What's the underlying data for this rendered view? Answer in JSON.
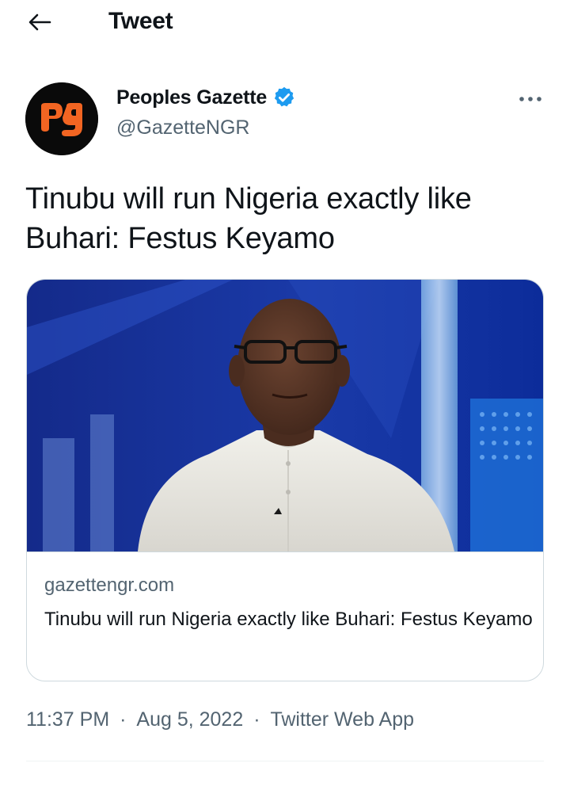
{
  "topbar": {
    "back_icon": "arrow-left-icon",
    "title": "Tweet"
  },
  "author": {
    "avatar_text": "pg",
    "avatar_colors": {
      "background": "#0a0a0a",
      "logo": "#f26522"
    },
    "display_name": "Peoples Gazette",
    "verified_icon": "verified-badge-icon",
    "verified_color": "#1d9bf0",
    "handle": "@GazetteNGR",
    "more_icon": "more-horizontal-icon"
  },
  "tweet": {
    "text": "Tinubu will run Nigeria exactly like Buhari: Festus Keyamo"
  },
  "link_card": {
    "image": "photo of a man in a white shirt and glasses in a TV studio",
    "domain": "gazettengr.com",
    "title": "Tinubu will run Nigeria exactly like Buhari: Festus Keyamo"
  },
  "meta": {
    "time": "11:37 PM",
    "separator": "·",
    "date": "Aug 5, 2022",
    "source": "Twitter Web App"
  }
}
